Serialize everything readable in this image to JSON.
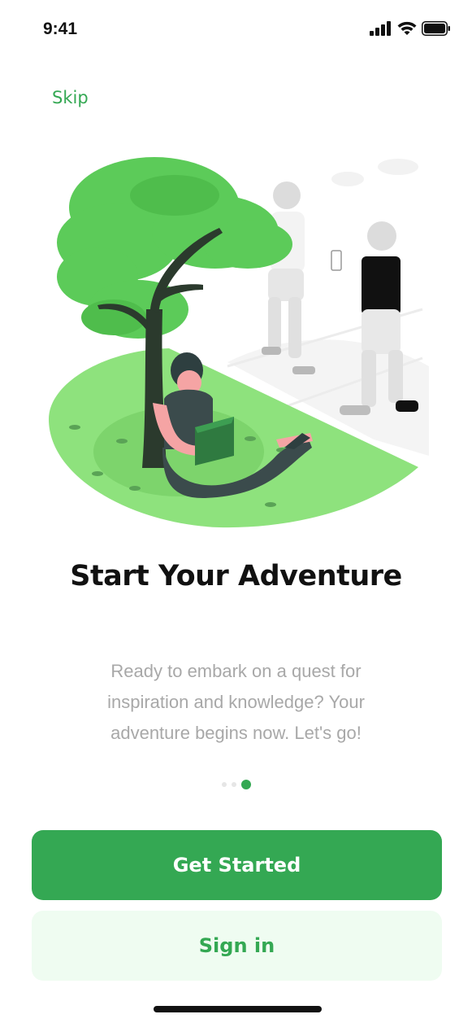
{
  "status_bar": {
    "time": "9:41",
    "icons": [
      "signal-icon",
      "wifi-icon",
      "battery-icon"
    ]
  },
  "skip_label": "Skip",
  "illustration": {
    "name": "person-reading-under-tree-illustration"
  },
  "title": "Start Your Adventure",
  "description": "Ready to embark on a quest for inspiration and knowledge? Your adventure begins now. Let's go!",
  "pagination": {
    "total": 3,
    "active_index": 2
  },
  "buttons": {
    "primary_label": "Get Started",
    "secondary_label": "Sign in"
  },
  "colors": {
    "accent": "#34a853",
    "accent_light": "#effcf1",
    "text_primary": "#111111",
    "text_secondary": "#a8a8a8",
    "lawn": "#8ee27d"
  }
}
